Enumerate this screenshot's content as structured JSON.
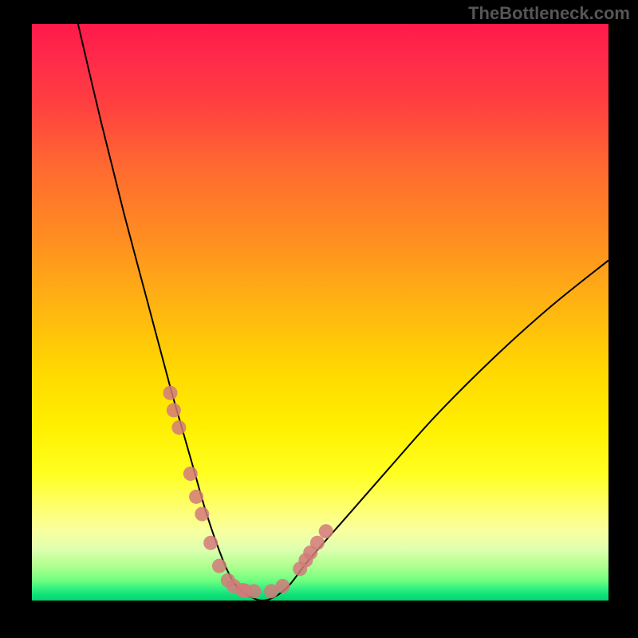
{
  "watermark": "TheBottleneck.com",
  "chart_data": {
    "type": "line",
    "title": "",
    "xlabel": "",
    "ylabel": "",
    "xlim": [
      0,
      100
    ],
    "ylim": [
      0,
      100
    ],
    "colors": {
      "gradient_top": "#ff1a4a",
      "gradient_mid": "#ffe000",
      "gradient_bottom": "#00d870",
      "curve": "#000000",
      "marker": "#d27a7a",
      "background": "#000000"
    },
    "series": [
      {
        "name": "bottleneck-curve",
        "x": [
          8,
          12,
          16,
          20,
          24,
          26,
          28,
          30,
          32,
          34,
          36,
          40,
          44,
          48,
          55,
          62,
          70,
          80,
          90,
          100
        ],
        "y": [
          100,
          83,
          67,
          52,
          37,
          30,
          23,
          16,
          10,
          5,
          2,
          0,
          2,
          7,
          15,
          23,
          32,
          42,
          51,
          59
        ]
      }
    ],
    "markers": {
      "name": "highlighted-points",
      "x": [
        24.0,
        24.6,
        25.5,
        27.5,
        28.5,
        29.5,
        31.0,
        32.5,
        34.0,
        35.0,
        36.5,
        37.0,
        38.5,
        41.5,
        43.5,
        46.5,
        47.5,
        48.3,
        49.5,
        51.0
      ],
      "y": [
        36,
        33,
        30,
        22,
        18,
        15,
        10,
        6,
        3.5,
        2.5,
        1.8,
        1.7,
        1.6,
        1.6,
        2.5,
        5.5,
        7,
        8.3,
        10,
        12
      ]
    }
  }
}
